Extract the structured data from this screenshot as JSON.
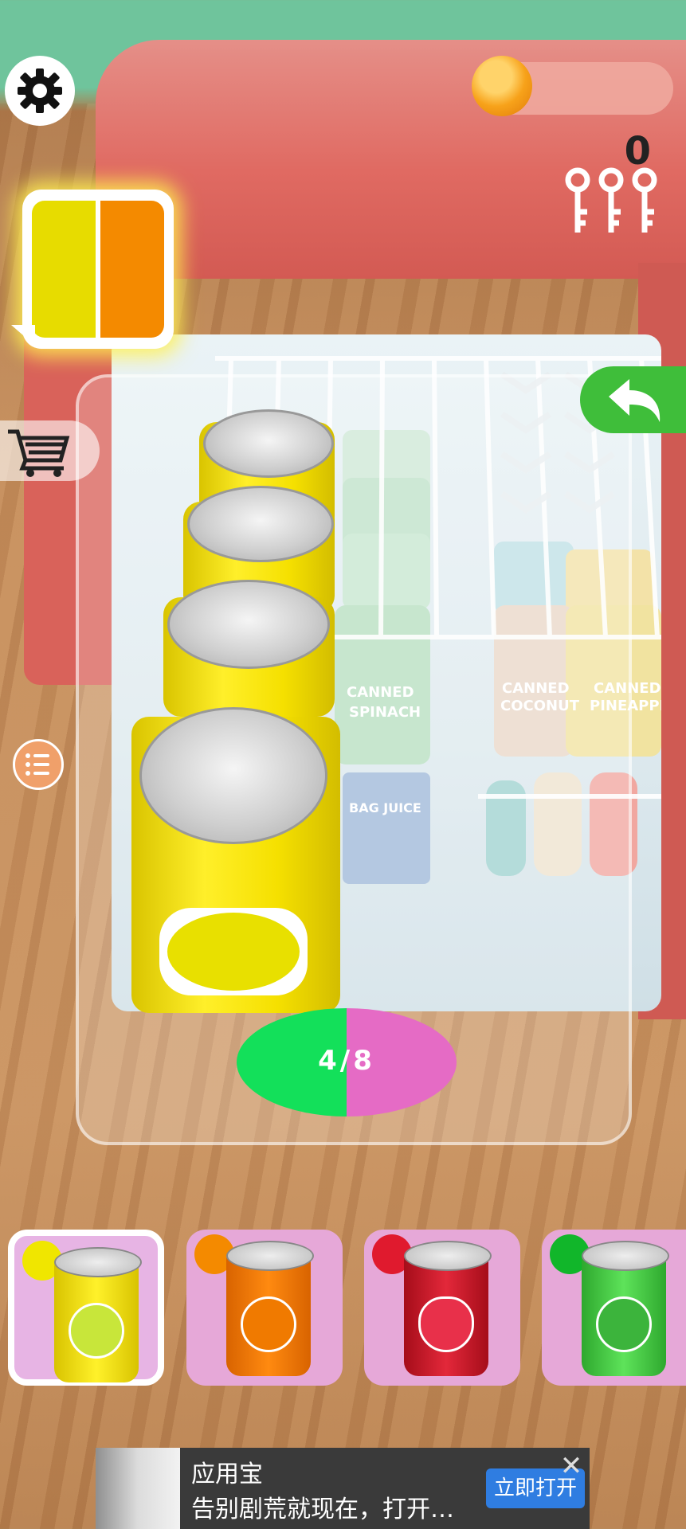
{
  "hud": {
    "coins": "0",
    "progress": "4/8",
    "progress_fraction": 0.5,
    "target_colors": [
      "#e7dc00",
      "#f48a00"
    ],
    "progress_colors": [
      "#13e05a",
      "#e56bc5"
    ],
    "icons": [
      "gear-icon",
      "coin-icon",
      "key-icon",
      "cart-icon",
      "undo-icon",
      "list-icon"
    ]
  },
  "fridge": {
    "labels": [
      "CANNED SPINACH",
      "CANNED COCONUT",
      "CANNED PINEAPPLE",
      "BAG JUICE"
    ]
  },
  "can_slots": [
    {
      "color": "#f0e600",
      "flavor": "lemon",
      "selected": true
    },
    {
      "color": "#f48a00",
      "flavor": "orange",
      "selected": false
    },
    {
      "color": "#e01a2e",
      "flavor": "strawberry",
      "selected": false
    },
    {
      "color": "#11b62a",
      "flavor": "lime",
      "selected": false
    }
  ],
  "ad": {
    "title": "应用宝",
    "subtitle": "告别剧荒就现在，打开…",
    "button": "立即打开",
    "close": "✕"
  }
}
